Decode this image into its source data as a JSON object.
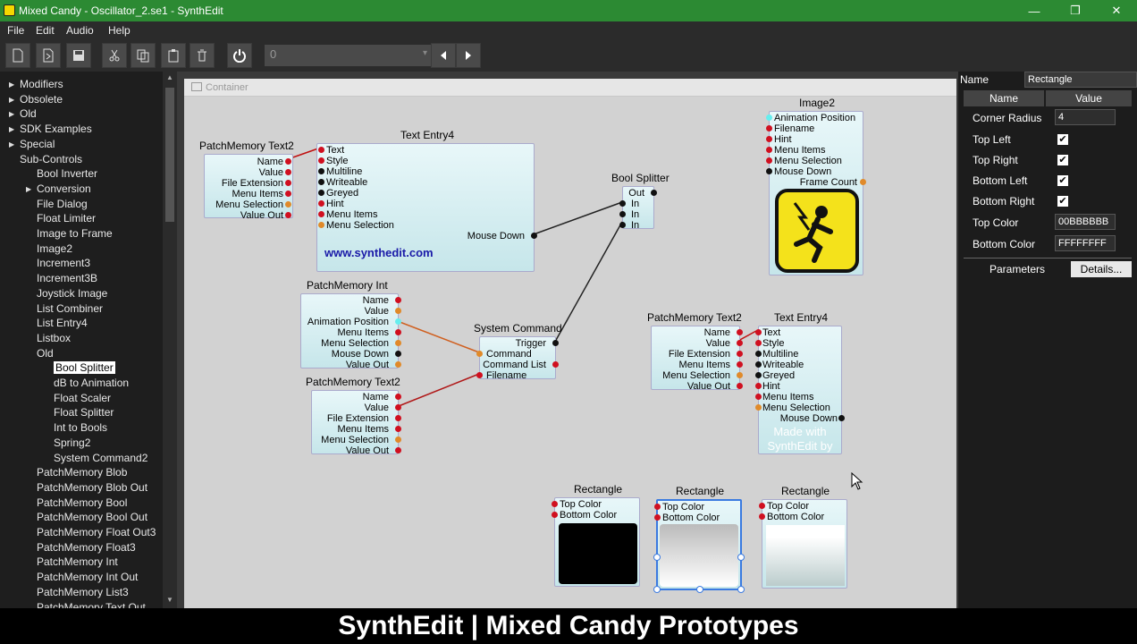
{
  "window": {
    "title": "Mixed Candy - Oscillator_2.se1 - SynthEdit"
  },
  "menu": [
    "File",
    "Edit",
    "Audio",
    "Help"
  ],
  "toolbar": {
    "combo_value": "0"
  },
  "sidebar": {
    "items": [
      {
        "label": "Modifiers",
        "level": 0,
        "arrow": true
      },
      {
        "label": "Obsolete",
        "level": 0,
        "arrow": true
      },
      {
        "label": "Old",
        "level": 0,
        "arrow": true
      },
      {
        "label": "SDK Examples",
        "level": 0,
        "arrow": true
      },
      {
        "label": "Special",
        "level": 0,
        "arrow": true
      },
      {
        "label": "Sub-Controls",
        "level": 0,
        "expanded": true
      },
      {
        "label": "Bool Inverter",
        "level": 1
      },
      {
        "label": "Conversion",
        "level": 1,
        "arrow": true
      },
      {
        "label": "File Dialog",
        "level": 1
      },
      {
        "label": "Float Limiter",
        "level": 1
      },
      {
        "label": "Image to Frame",
        "level": 1
      },
      {
        "label": "Image2",
        "level": 1
      },
      {
        "label": "Increment3",
        "level": 1
      },
      {
        "label": "Increment3B",
        "level": 1
      },
      {
        "label": "Joystick Image",
        "level": 1
      },
      {
        "label": "List Combiner",
        "level": 1
      },
      {
        "label": "List Entry4",
        "level": 1
      },
      {
        "label": "Listbox",
        "level": 1
      },
      {
        "label": "Old",
        "level": 1,
        "expanded": true
      },
      {
        "label": "Bool Splitter",
        "level": 2,
        "selected": true
      },
      {
        "label": "dB to Animation",
        "level": 2
      },
      {
        "label": "Float Scaler",
        "level": 2
      },
      {
        "label": "Float Splitter",
        "level": 2
      },
      {
        "label": "Int to Bools",
        "level": 2
      },
      {
        "label": "Spring2",
        "level": 2
      },
      {
        "label": "System Command2",
        "level": 2
      },
      {
        "label": "PatchMemory Blob",
        "level": 1
      },
      {
        "label": "PatchMemory Blob Out",
        "level": 1
      },
      {
        "label": "PatchMemory Bool",
        "level": 1
      },
      {
        "label": "PatchMemory Bool Out",
        "level": 1
      },
      {
        "label": "PatchMemory Float Out3",
        "level": 1
      },
      {
        "label": "PatchMemory Float3",
        "level": 1
      },
      {
        "label": "PatchMemory Int",
        "level": 1
      },
      {
        "label": "PatchMemory Int Out",
        "level": 1
      },
      {
        "label": "PatchMemory List3",
        "level": 1
      },
      {
        "label": "PatchMemory Text Out",
        "level": 1
      }
    ]
  },
  "container": {
    "label": "Container"
  },
  "modules": {
    "pm_text2_a": {
      "title": "PatchMemory Text2",
      "pins": [
        "Name",
        "Value",
        "File Extension",
        "Menu Items",
        "Menu Selection",
        "Value Out"
      ]
    },
    "text_entry4_a": {
      "title": "Text Entry4",
      "pins": [
        "Text",
        "Style",
        "Multiline",
        "Writeable",
        "Greyed",
        "Hint",
        "Menu Items",
        "Menu Selection"
      ],
      "out": "Mouse Down",
      "url": "www.synthedit.com"
    },
    "bool_splitter": {
      "title": "Bool Splitter",
      "out": "Out",
      "pins": [
        "In",
        "In",
        "In"
      ]
    },
    "image2": {
      "title": "Image2",
      "pins": [
        "Animation Position",
        "Filename",
        "Hint",
        "Menu Items",
        "Menu Selection",
        "Mouse Down"
      ],
      "out": "Frame Count"
    },
    "pm_int": {
      "title": "PatchMemory Int",
      "pins": [
        "Name",
        "Value",
        "Animation Position",
        "Menu Items",
        "Menu Selection",
        "Mouse Down",
        "Value Out"
      ]
    },
    "sys_cmd": {
      "title": "System Command",
      "pins": [
        "Trigger",
        "Command",
        "Command List",
        "Filename"
      ]
    },
    "pm_text2_b": {
      "title": "PatchMemory Text2",
      "pins": [
        "Name",
        "Value",
        "File Extension",
        "Menu Items",
        "Menu Selection",
        "Value Out"
      ]
    },
    "pm_text2_c": {
      "title": "PatchMemory Text2",
      "pins": [
        "Name",
        "Value",
        "File Extension",
        "Menu Items",
        "Menu Selection",
        "Value Out"
      ]
    },
    "text_entry4_b": {
      "title": "Text Entry4",
      "pins": [
        "Text",
        "Style",
        "Multiline",
        "Writeable",
        "Greyed",
        "Hint",
        "Menu Items",
        "Menu Selection"
      ],
      "out": "Mouse Down",
      "overlay": [
        "Made with",
        "SynthEdit by"
      ]
    },
    "rect1": {
      "title": "Rectangle",
      "pins": [
        "Top Color",
        "Bottom Color"
      ]
    },
    "rect2": {
      "title": "Rectangle",
      "pins": [
        "Top Color",
        "Bottom Color"
      ]
    },
    "rect3": {
      "title": "Rectangle",
      "pins": [
        "Top Color",
        "Bottom Color"
      ]
    }
  },
  "properties": {
    "name_label": "Name",
    "name_value": "Rectangle",
    "col_name": "Name",
    "col_value": "Value",
    "rows": [
      {
        "label": "Corner Radius",
        "type": "text",
        "value": "4"
      },
      {
        "label": "Top Left",
        "type": "check",
        "value": "✔"
      },
      {
        "label": "Top Right",
        "type": "check",
        "value": "✔"
      },
      {
        "label": "Bottom Left",
        "type": "check",
        "value": "✔"
      },
      {
        "label": "Bottom Right",
        "type": "check",
        "value": "✔"
      },
      {
        "label": "Top Color",
        "type": "text",
        "value": "00BBBBBB"
      },
      {
        "label": "Bottom Color",
        "type": "text",
        "value": "FFFFFFFF"
      }
    ],
    "tab_parameters": "Parameters",
    "tab_details": "Details..."
  },
  "caption": "SynthEdit | Mixed Candy Prototypes"
}
